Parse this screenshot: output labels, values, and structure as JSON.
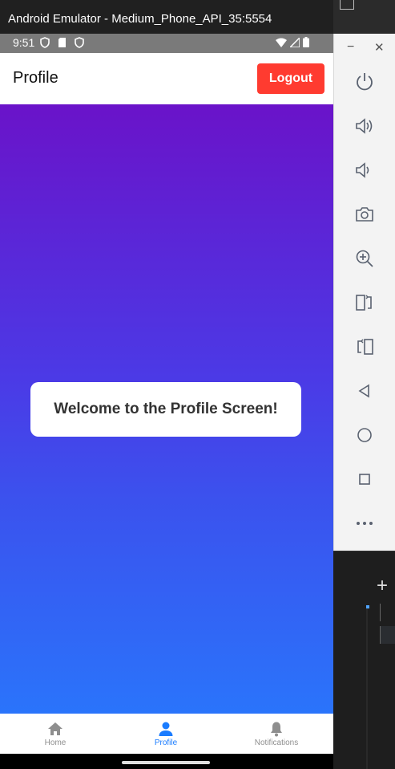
{
  "window": {
    "title": "Android Emulator - Medium_Phone_API_35:5554"
  },
  "statusbar": {
    "time": "9:51",
    "icons_left": [
      "shield-icon",
      "sd-card-icon",
      "shield-icon"
    ],
    "icons_right": [
      "wifi-icon",
      "signal-icon",
      "battery-icon"
    ]
  },
  "appbar": {
    "title": "Profile",
    "logout_label": "Logout"
  },
  "content": {
    "welcome_text": "Welcome to the Profile Screen!"
  },
  "tabs": [
    {
      "label": "Home",
      "icon": "home-icon",
      "active": false
    },
    {
      "label": "Profile",
      "icon": "person-icon",
      "active": true
    },
    {
      "label": "Notifications",
      "icon": "bell-icon",
      "active": false
    }
  ],
  "toolbar": {
    "buttons": [
      "power-icon",
      "volume-up-icon",
      "volume-down-icon",
      "camera-icon",
      "zoom-icon",
      "rotate-left-icon",
      "rotate-right-icon",
      "back-icon",
      "home-icon",
      "overview-icon",
      "more-icon"
    ]
  },
  "colors": {
    "accent": "#1a7cff",
    "logout": "#ff3b30",
    "gradient_top": "#6a13c9",
    "gradient_bottom": "#2a74fb"
  }
}
